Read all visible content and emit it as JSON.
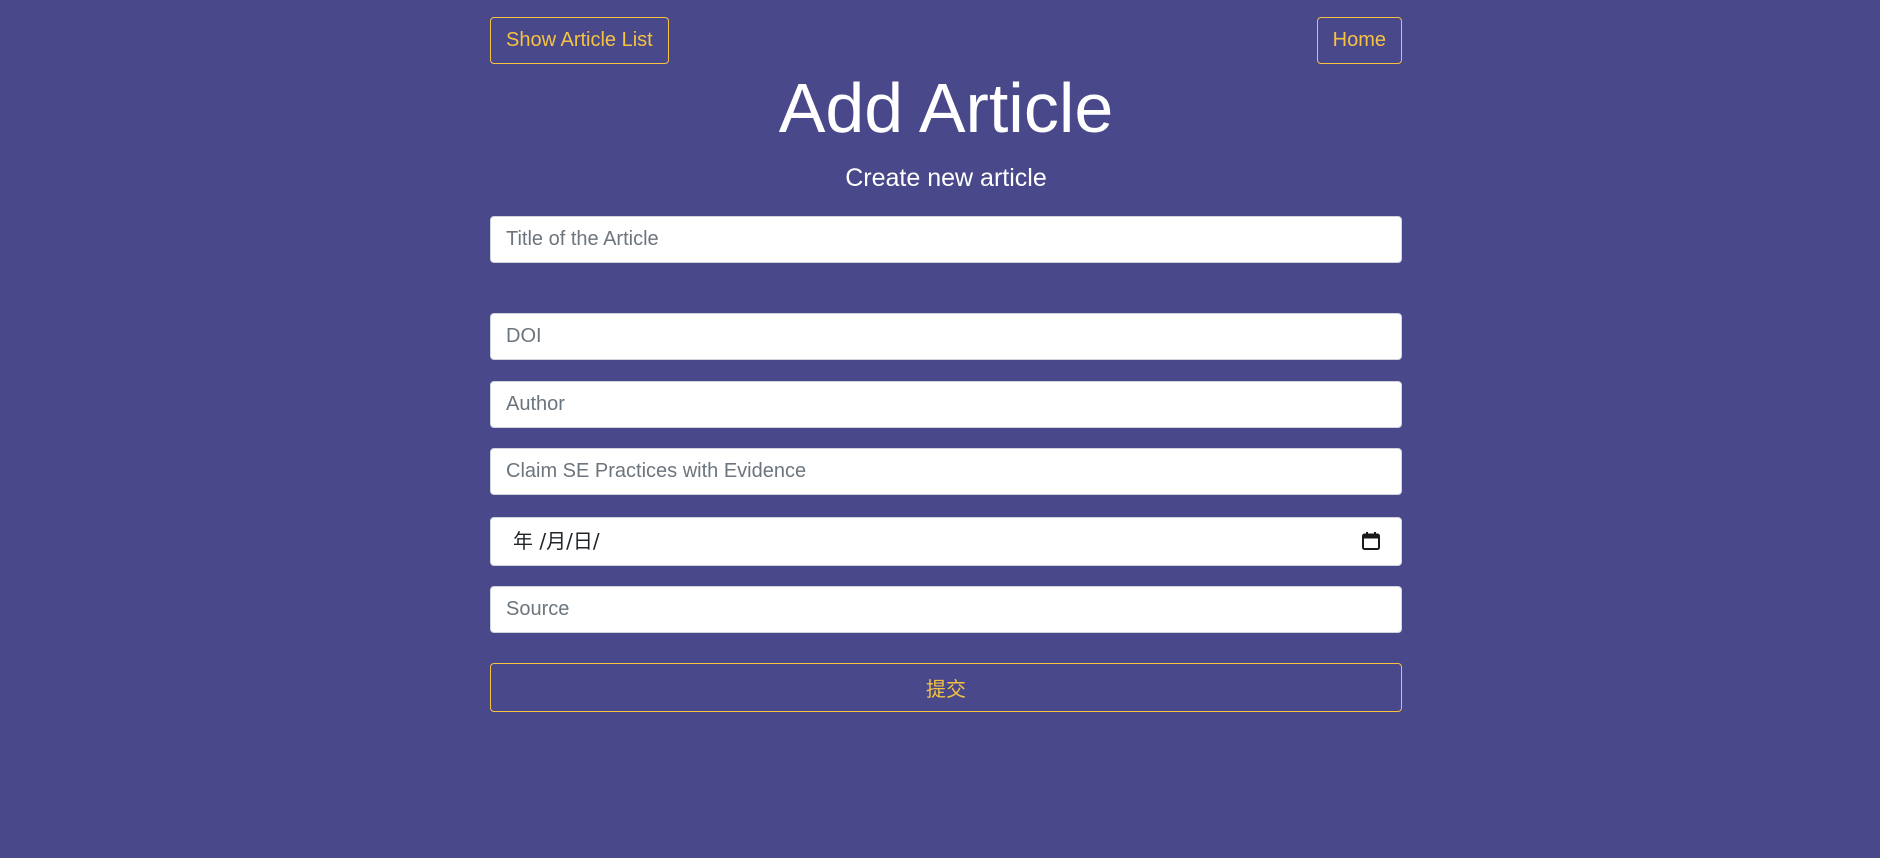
{
  "nav": {
    "show_list_label": "Show Article List",
    "home_label": "Home"
  },
  "header": {
    "title": "Add Article",
    "subtitle": "Create new article"
  },
  "form": {
    "title_placeholder": "Title of the Article",
    "doi_placeholder": "DOI",
    "author_placeholder": "Author",
    "claim_placeholder": "Claim SE Practices with Evidence",
    "date_display": "年 /月/日/",
    "source_placeholder": "Source",
    "submit_label": "提交"
  },
  "colors": {
    "background": "#48488a",
    "accent": "#f5c242",
    "text": "#ffffff"
  },
  "icons": {
    "date_picker": "calendar-icon"
  }
}
